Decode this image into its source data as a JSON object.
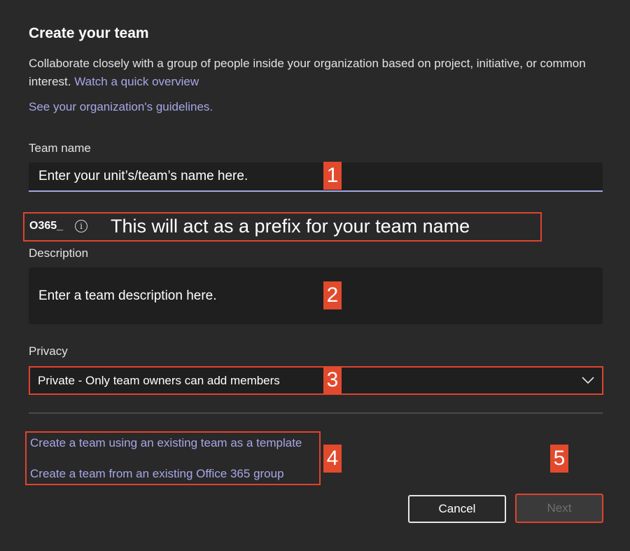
{
  "dialog": {
    "title": "Create your team",
    "intro_text": "Collaborate closely with a group of people inside your organization based on project, initiative, or common interest.",
    "overview_link": "Watch a quick overview",
    "guidelines_link": "See your organization's guidelines."
  },
  "team_name": {
    "label": "Team name",
    "value": "Enter your unit’s/team’s name here."
  },
  "prefix": {
    "code": "O365_",
    "info_icon": "info-icon",
    "note": "This will act as a prefix for your team name"
  },
  "description": {
    "label": "Description",
    "value": "Enter a team description here."
  },
  "privacy": {
    "label": "Privacy",
    "selected": "Private - Only team owners can add members",
    "dropdown_icon": "chevron-down-icon"
  },
  "alt_links": {
    "template": "Create a team using an existing team as a template",
    "office_group": "Create a team from an existing Office 365 group"
  },
  "buttons": {
    "cancel": "Cancel",
    "next": "Next"
  },
  "callout_numbers": [
    "1",
    "2",
    "3",
    "4",
    "5"
  ],
  "colors": {
    "background": "#292929",
    "input_bg": "#1f1f1f",
    "link": "#a6a7e8",
    "callout_red": "#e24a2d",
    "focus_underline": "#a4a7e0"
  }
}
